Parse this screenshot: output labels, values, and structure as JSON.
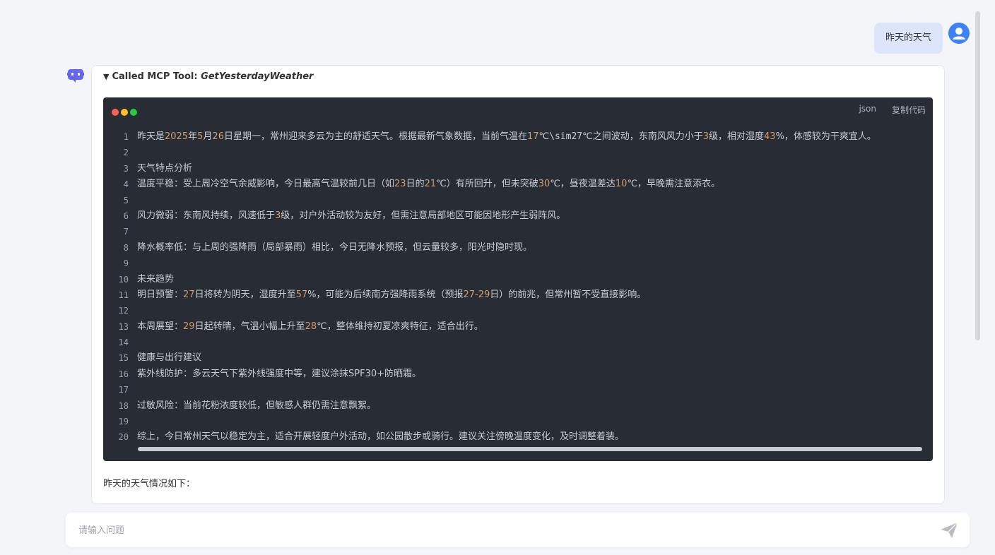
{
  "chat": {
    "user_message": "昨天的天气",
    "tool_call": {
      "prefix": "Called MCP Tool:",
      "name": "GetYesterdayWeather"
    },
    "code": {
      "lang": "json",
      "copy_label": "复制代码",
      "lines": [
        {
          "n": "1",
          "parts": [
            [
              "t",
              "昨天是"
            ],
            [
              "n",
              "2025"
            ],
            [
              "t",
              "年"
            ],
            [
              "n",
              "5"
            ],
            [
              "t",
              "月"
            ],
            [
              "n",
              "26"
            ],
            [
              "t",
              "日星期一，常州迎来多云为主的舒适天气。根据最新气象数据，当前气温在"
            ],
            [
              "n",
              "17"
            ],
            [
              "t",
              "℃"
            ],
            [
              "m",
              "\\sim27"
            ],
            [
              "t",
              "℃之间波动，东南风风力小于"
            ],
            [
              "n",
              "3"
            ],
            [
              "t",
              "级，相对湿度"
            ],
            [
              "n",
              "43"
            ],
            [
              "t",
              "%，体感较为干爽宜人。"
            ]
          ]
        },
        {
          "n": "2",
          "parts": []
        },
        {
          "n": "3",
          "parts": [
            [
              "t",
              "天气特点分析"
            ]
          ]
        },
        {
          "n": "4",
          "parts": [
            [
              "t",
              "温度平稳：受上周冷空气余威影响，今日最高气温较前几日（如"
            ],
            [
              "n",
              "23"
            ],
            [
              "t",
              "日的"
            ],
            [
              "n",
              "21"
            ],
            [
              "t",
              "℃）有所回升，但未突破"
            ],
            [
              "n",
              "30"
            ],
            [
              "t",
              "℃，昼夜温差达"
            ],
            [
              "n",
              "10"
            ],
            [
              "t",
              "℃，早晚需注意添衣。"
            ]
          ]
        },
        {
          "n": "5",
          "parts": []
        },
        {
          "n": "6",
          "parts": [
            [
              "t",
              "风力微弱：东南风持续，风速低于"
            ],
            [
              "n",
              "3"
            ],
            [
              "t",
              "级，对户外活动较为友好，但需注意局部地区可能因地形产生弱阵风。"
            ]
          ]
        },
        {
          "n": "7",
          "parts": []
        },
        {
          "n": "8",
          "parts": [
            [
              "t",
              "降水概率低：与上周的强降雨（局部暴雨）相比，今日无降水预报，但云量较多，阳光时隐时现。"
            ]
          ]
        },
        {
          "n": "9",
          "parts": []
        },
        {
          "n": "10",
          "parts": [
            [
              "t",
              "未来趋势"
            ]
          ]
        },
        {
          "n": "11",
          "parts": [
            [
              "t",
              "明日预警："
            ],
            [
              "n",
              "27"
            ],
            [
              "t",
              "日将转为阴天，湿度升至"
            ],
            [
              "n",
              "57"
            ],
            [
              "t",
              "%，可能为后续南方强降雨系统（预报"
            ],
            [
              "n",
              "27-29"
            ],
            [
              "t",
              "日）的前兆，但常州暂不受直接影响。"
            ]
          ]
        },
        {
          "n": "12",
          "parts": []
        },
        {
          "n": "13",
          "parts": [
            [
              "t",
              "本周展望："
            ],
            [
              "n",
              "29"
            ],
            [
              "t",
              "日起转晴，气温小幅上升至"
            ],
            [
              "n",
              "28"
            ],
            [
              "t",
              "℃，整体维持初夏凉爽特征，适合出行。"
            ]
          ]
        },
        {
          "n": "14",
          "parts": []
        },
        {
          "n": "15",
          "parts": [
            [
              "t",
              "健康与出行建议"
            ]
          ]
        },
        {
          "n": "16",
          "parts": [
            [
              "t",
              "紫外线防护：多云天气下紫外线强度中等，建议涂抹SPF30+防晒霜。"
            ]
          ]
        },
        {
          "n": "17",
          "parts": []
        },
        {
          "n": "18",
          "parts": [
            [
              "t",
              "过敏风险：当前花粉浓度较低，但敏感人群仍需注意飘絮。"
            ]
          ]
        },
        {
          "n": "19",
          "parts": []
        },
        {
          "n": "20",
          "parts": [
            [
              "t",
              "综上，今日常州天气以稳定为主，适合开展轻度户外活动，如公园散步或骑行。建议关注傍晚温度变化，及时调整着装。"
            ]
          ]
        }
      ]
    },
    "answer_intro": "昨天的天气情况如下："
  },
  "input": {
    "placeholder": "请输入问题",
    "value": ""
  },
  "colors": {
    "accent": "#3b82f6",
    "bot_icon": "#6366f1",
    "code_bg": "#282c34",
    "number": "#d19a66"
  }
}
